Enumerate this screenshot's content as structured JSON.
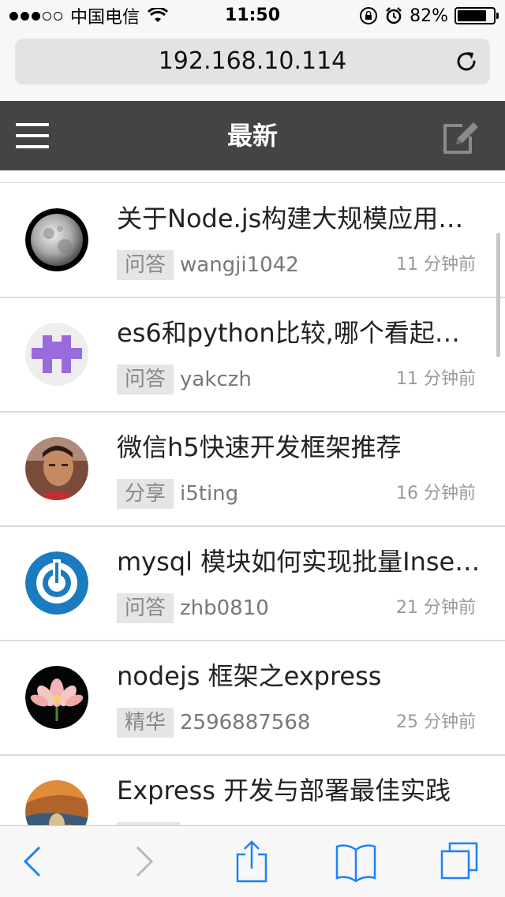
{
  "status_bar": {
    "carrier": "中国电信",
    "time": "11:50",
    "battery": "82%",
    "battery_level": 0.82,
    "signal_strength": 3,
    "signal_max": 5
  },
  "browser": {
    "url": "192.168.10.114"
  },
  "navbar": {
    "title": "最新"
  },
  "topics": [
    {
      "title": "关于Node.js构建大规模应用…",
      "tag": "问答",
      "author": "wangji1042",
      "time": "11 分钟前",
      "avatar": "moon-avatar"
    },
    {
      "title": "es6和python比较,哪个看起来…",
      "tag": "问答",
      "author": "yakczh",
      "time": "11 分钟前",
      "avatar": "identicon-avatar"
    },
    {
      "title": "微信h5快速开发框架推荐",
      "tag": "分享",
      "author": "i5ting",
      "time": "16 分钟前",
      "avatar": "photo-avatar"
    },
    {
      "title": "mysql 模块如何实现批量Inser…",
      "tag": "问答",
      "author": "zhb0810",
      "time": "21 分钟前",
      "avatar": "power-logo-avatar"
    },
    {
      "title": "nodejs 框架之express",
      "tag": "精华",
      "author": "2596887568",
      "time": "25 分钟前",
      "avatar": "lotus-avatar"
    },
    {
      "title": "Express 开发与部署最佳实践",
      "tag": "",
      "author": "",
      "time": "",
      "avatar": "painting-avatar"
    }
  ],
  "colors": {
    "navbar_bg": "#444444",
    "tag_bg": "#e5e5e5",
    "ios_blue": "#1a82fb",
    "identicon_purple": "#9a6bdc"
  },
  "toolbar_icons": [
    "back-icon",
    "forward-icon",
    "share-icon",
    "bookmarks-icon",
    "tabs-icon"
  ]
}
